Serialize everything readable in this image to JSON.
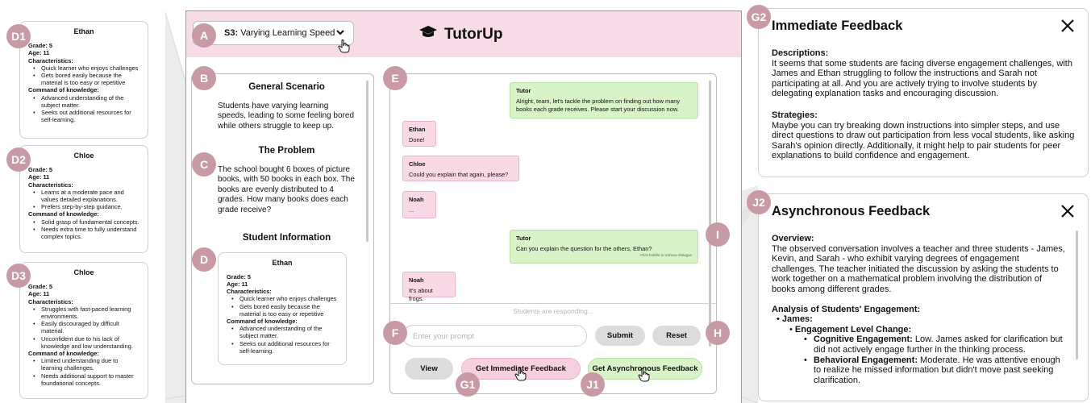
{
  "badges": {
    "a": "A",
    "b": "B",
    "c": "C",
    "d": "D",
    "e": "E",
    "f": "F",
    "h": "H",
    "i": "I",
    "g1": "G1",
    "j1": "J1",
    "g2": "G2",
    "j2": "J2",
    "d1": "D1",
    "d2": "D2",
    "d3": "D3"
  },
  "students": [
    {
      "name": "Ethan",
      "grade": "Grade: 5",
      "age": "Age: 11",
      "char_label": "Characteristics:",
      "chars": [
        "Quick learner who enjoys challenges",
        "Gets bored easily because the material is too easy or repetitive"
      ],
      "know_label": "Command of knowledge:",
      "know": [
        "Advanced understanding of the subject matter.",
        "Seeks out additional resources for self-learning."
      ]
    },
    {
      "name": "Chloe",
      "grade": "Grade: 5",
      "age": "Age: 11",
      "char_label": "Characteristics:",
      "chars": [
        "Learns at a moderate pace and values detailed explanations.",
        "Prefers step-by-step guidance."
      ],
      "know_label": "Command of knowledge:",
      "know": [
        "Solid grasp of fundamental concepts.",
        "Needs extra time to fully understand complex topics."
      ]
    },
    {
      "name": "Chloe",
      "grade": "Grade: 5",
      "age": "Age: 11",
      "char_label": "Characteristics:",
      "chars": [
        "Struggles with fast-paced learning environments.",
        "Easily discouraged by difficult material.",
        "Unconfident due to his lack of knowledge and low understanding."
      ],
      "know_label": "Command of knowledge:",
      "know": [
        "Limited understanding due to learning challenges.",
        "Needs additional support to master foundational concepts."
      ]
    }
  ],
  "header": {
    "scenario_code": "S3:",
    "scenario_name": "Varying Learning Speed",
    "app_name": "TutorUp"
  },
  "scenario": {
    "general_title": "General Scenario",
    "general_text": "Students have varying learning speeds, leading to some feeling bored while others struggle to keep up.",
    "problem_title": "The Problem",
    "problem_text": "The school bought 6 boxes of picture books, with 50 books in each box. The books are evenly distributed to 4 grades. How many books does each grade receive?",
    "info_title": "Student Information"
  },
  "chat": {
    "messages": [
      {
        "who": "Tutor",
        "text": "Alright, team, let's tackle the problem on finding out how many books each grade receives. Please start your discussion now."
      },
      {
        "who": "Ethan",
        "text": "Done!"
      },
      {
        "who": "Chloe",
        "text": "Could you explain that again, please?"
      },
      {
        "who": "Noah",
        "text": "..."
      },
      {
        "who": "Tutor",
        "text": "Can you explain the question for the others, Ethan?",
        "hint": "Click bubble to retrieve dialogue"
      },
      {
        "who": "Noah",
        "text": "It's about frogs."
      }
    ],
    "status": "Students are responding...",
    "input_placeholder": "Enter your prompt",
    "submit": "Submit",
    "reset": "Reset",
    "view": "View",
    "immediate": "Get Immediate Feedback",
    "async": "Get Asynchronous Feedback"
  },
  "immediate_feedback": {
    "title": "Immediate Feedback",
    "desc_label": "Descriptions:",
    "desc": "It seems that some students are facing diverse engagement challenges, with James and Ethan struggling to follow the instructions and Sarah not participating at all. And you are actively trying to involve students by delegating explanation tasks and encouraging discussion.",
    "strat_label": "Strategies:",
    "strat": "Maybe you can try breaking down instructions into simpler steps, and use direct questions to draw out participation from less vocal students, like asking Sarah's opinion directly. Additionally, it might help to pair students for peer explanations to build confidence and engagement."
  },
  "async_feedback": {
    "title": "Asynchronous Feedback",
    "overview_label": "Overview:",
    "overview": "The observed conversation involves a teacher and three students - James, Kevin, and Sarah - who exhibit varying degrees of engagement challenges. The teacher initiated the discussion by asking the students to work together on a mathematical problem involving the distribution of books among different grades.",
    "analysis_label": "Analysis of Students' Engagement:",
    "student": "James:",
    "change_label": "Engagement Level Change:",
    "cog_label": "Cognitive Engagement:",
    "cog": "Low. James asked for clarification but did not actively engage further in the thinking process.",
    "beh_label": "Behavioral Engagement:",
    "beh": "Moderate. He was attentive enough to realize he missed information but didn't move past seeking clarification."
  }
}
